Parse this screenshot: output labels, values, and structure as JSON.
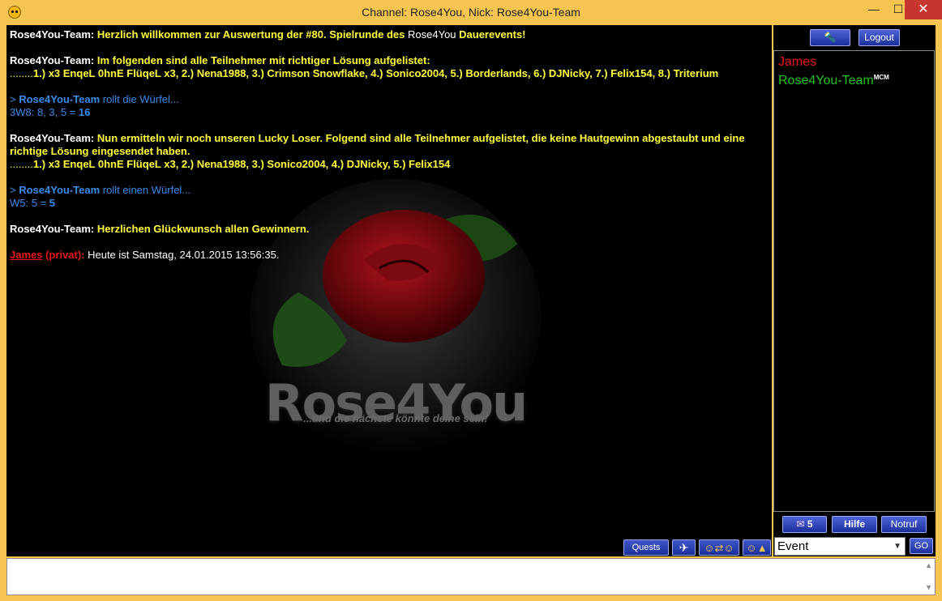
{
  "window": {
    "title": "Channel: Rose4You,  Nick: Rose4You-Team",
    "minimize": "—",
    "maximize": "☐",
    "close": "✕"
  },
  "watermark": {
    "title": "Rose4You",
    "subtitle": "...und die nächste könnte deine sein!"
  },
  "messages": [
    {
      "nick": "Rose4You-Team:",
      "text1": "Herzlich willkommen zur Auswertung der #80. Spielrunde des ",
      "text2": "Rose4You",
      "text3": " Dauerevents!"
    },
    {
      "nick": "Rose4You-Team:",
      "text1": "Im folgenden sind alle Teilnehmer mit richtiger Lösung aufgelistet:",
      "dots": "........",
      "list": "1.) x3 EnqeL 0hnE FlüqeL x3, 2.) Nena1988, 3.) Crimson Snowflake, 4.) Sonico2004, 5.) Borderlands, 6.) DJNicky, 7.) Felix154, 8.) Triterium"
    },
    {
      "prefix": "> ",
      "nick": "Rose4You-Team",
      "action": " rollt die Würfel...",
      "result_label": "3W8: 8, 3, 5 = ",
      "result": "16"
    },
    {
      "nick": "Rose4You-Team:",
      "text1": "Nun ermitteln wir noch unseren Lucky Loser. Folgend sind alle Teilnehmer aufgelistet, die keine Hautgewinn abgestaubt und eine richtige Lösung eingesendet haben.",
      "dots": "........",
      "list": "1.) x3 EnqeL 0hnE FlüqeL x3, 2.) Nena1988, 3.) Sonico2004, 4.) DJNicky, 5.) Felix154"
    },
    {
      "prefix": "> ",
      "nick": "Rose4You-Team",
      "action": " rollt einen Würfel...",
      "result_label": "W5: 5 = ",
      "result": "5"
    },
    {
      "nick": "Rose4You-Team:",
      "text1": "Herzlichen Glückwunsch allen Gewinnern."
    },
    {
      "nick": "James",
      "private": " (privat):",
      "text1": " Heute ist Samstag, 24.01.2015 13:56:35."
    }
  ],
  "chat_buttons": {
    "quests": "Quests",
    "plane": "✈",
    "smileys": "☺⇄☺",
    "smiley_menu": "☺▲"
  },
  "panel": {
    "flashlight": "🔦",
    "logout": "Logout",
    "users": [
      {
        "name": "James",
        "color": "#e8161c"
      },
      {
        "name": "Rose4You-Team",
        "color": "#22c322",
        "badge": "MCM"
      }
    ],
    "mail_count": "5",
    "mail_icon": "✉",
    "help": "Hilfe",
    "emergency": "Notruf",
    "channel_select": "Event",
    "go": "GO"
  },
  "input": {
    "scroll_up": "▲",
    "scroll_down": "▼"
  }
}
